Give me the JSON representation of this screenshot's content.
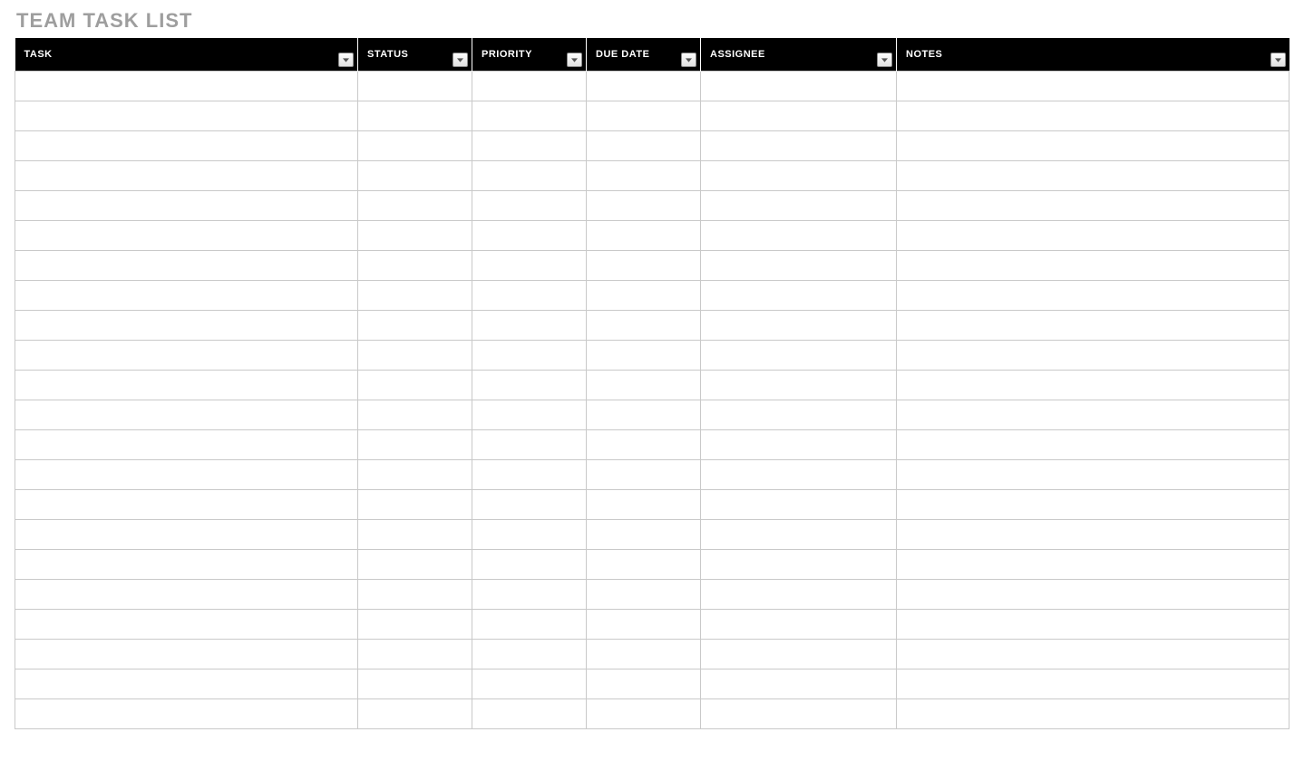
{
  "title": "TEAM TASK LIST",
  "columns": [
    {
      "key": "task",
      "label": "TASK"
    },
    {
      "key": "status",
      "label": "STATUS"
    },
    {
      "key": "priority",
      "label": "PRIORITY"
    },
    {
      "key": "due_date",
      "label": "DUE DATE"
    },
    {
      "key": "assignee",
      "label": "ASSIGNEE"
    },
    {
      "key": "notes",
      "label": "NOTES"
    }
  ],
  "rows": [
    {
      "task": "",
      "status": "",
      "priority": "",
      "due_date": "",
      "assignee": "",
      "notes": ""
    },
    {
      "task": "",
      "status": "",
      "priority": "",
      "due_date": "",
      "assignee": "",
      "notes": ""
    },
    {
      "task": "",
      "status": "",
      "priority": "",
      "due_date": "",
      "assignee": "",
      "notes": ""
    },
    {
      "task": "",
      "status": "",
      "priority": "",
      "due_date": "",
      "assignee": "",
      "notes": ""
    },
    {
      "task": "",
      "status": "",
      "priority": "",
      "due_date": "",
      "assignee": "",
      "notes": ""
    },
    {
      "task": "",
      "status": "",
      "priority": "",
      "due_date": "",
      "assignee": "",
      "notes": ""
    },
    {
      "task": "",
      "status": "",
      "priority": "",
      "due_date": "",
      "assignee": "",
      "notes": ""
    },
    {
      "task": "",
      "status": "",
      "priority": "",
      "due_date": "",
      "assignee": "",
      "notes": ""
    },
    {
      "task": "",
      "status": "",
      "priority": "",
      "due_date": "",
      "assignee": "",
      "notes": ""
    },
    {
      "task": "",
      "status": "",
      "priority": "",
      "due_date": "",
      "assignee": "",
      "notes": ""
    },
    {
      "task": "",
      "status": "",
      "priority": "",
      "due_date": "",
      "assignee": "",
      "notes": ""
    },
    {
      "task": "",
      "status": "",
      "priority": "",
      "due_date": "",
      "assignee": "",
      "notes": ""
    },
    {
      "task": "",
      "status": "",
      "priority": "",
      "due_date": "",
      "assignee": "",
      "notes": ""
    },
    {
      "task": "",
      "status": "",
      "priority": "",
      "due_date": "",
      "assignee": "",
      "notes": ""
    },
    {
      "task": "",
      "status": "",
      "priority": "",
      "due_date": "",
      "assignee": "",
      "notes": ""
    },
    {
      "task": "",
      "status": "",
      "priority": "",
      "due_date": "",
      "assignee": "",
      "notes": ""
    },
    {
      "task": "",
      "status": "",
      "priority": "",
      "due_date": "",
      "assignee": "",
      "notes": ""
    },
    {
      "task": "",
      "status": "",
      "priority": "",
      "due_date": "",
      "assignee": "",
      "notes": ""
    },
    {
      "task": "",
      "status": "",
      "priority": "",
      "due_date": "",
      "assignee": "",
      "notes": ""
    },
    {
      "task": "",
      "status": "",
      "priority": "",
      "due_date": "",
      "assignee": "",
      "notes": ""
    },
    {
      "task": "",
      "status": "",
      "priority": "",
      "due_date": "",
      "assignee": "",
      "notes": ""
    },
    {
      "task": "",
      "status": "",
      "priority": "",
      "due_date": "",
      "assignee": "",
      "notes": ""
    }
  ]
}
